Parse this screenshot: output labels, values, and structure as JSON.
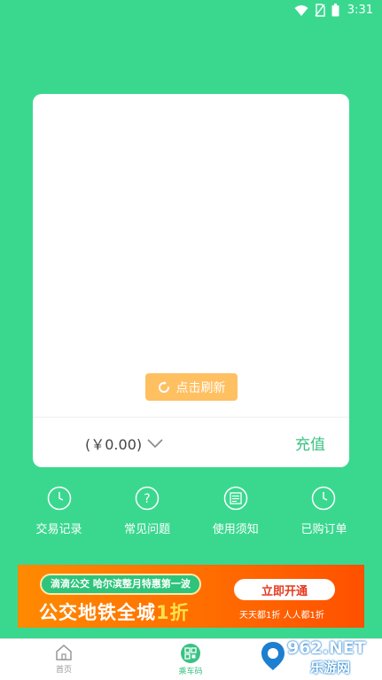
{
  "status_bar": {
    "time": "3:31",
    "icons": [
      "wifi-icon",
      "no-sim-icon",
      "battery-icon"
    ]
  },
  "card": {
    "refresh_label": "点击刷新",
    "balance": "(￥0.00)",
    "recharge_label": "充值"
  },
  "actions": [
    {
      "label": "交易记录",
      "icon": "clock-icon"
    },
    {
      "label": "常见问题",
      "icon": "question-icon"
    },
    {
      "label": "使用须知",
      "icon": "list-icon"
    },
    {
      "label": "已购订单",
      "icon": "clock-icon"
    }
  ],
  "banner": {
    "pill_text": "滴滴公交 哈尔滨整月特惠第一波",
    "headline_prefix": "公交地铁全城",
    "headline_highlight": "1折",
    "button_label": "立即开通",
    "subtext": "天天都1折  人人都1折"
  },
  "bottom_nav": [
    {
      "label": "首页",
      "icon": "home-icon",
      "active": false
    },
    {
      "label": "乘车码",
      "icon": "qr-code-icon",
      "active": true
    }
  ],
  "watermark": {
    "site": "962.NET",
    "name": "乐游网"
  },
  "colors": {
    "background": "#3ad88f",
    "accent": "#3ac283",
    "refresh": "#ffc062",
    "banner": "#ff6a00"
  }
}
